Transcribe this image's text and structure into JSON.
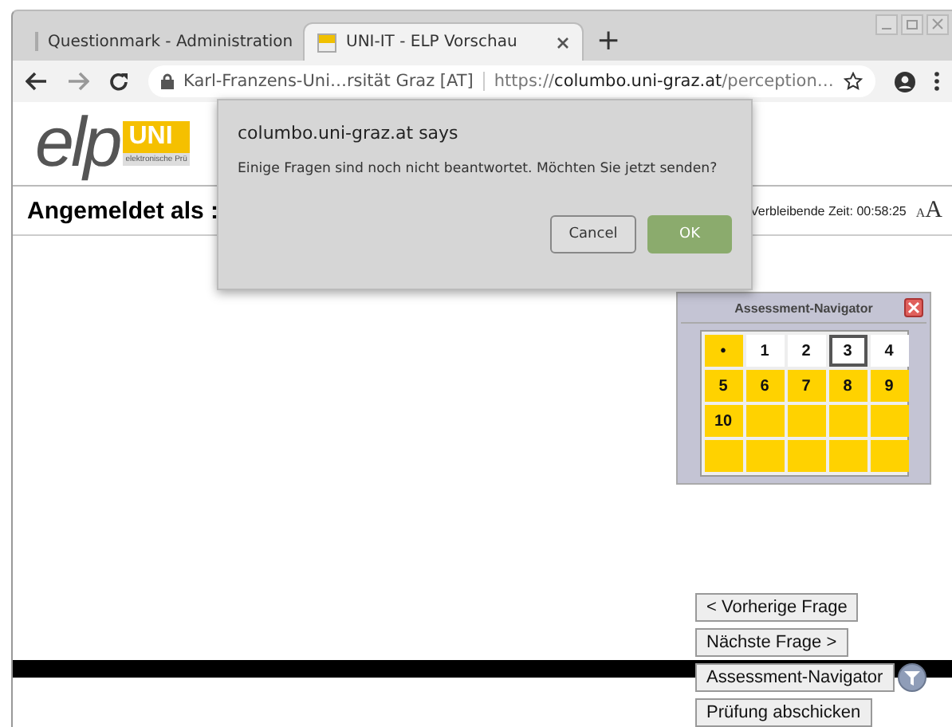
{
  "browser": {
    "tabs": [
      {
        "title": "Questionmark - Administration",
        "selected": false
      },
      {
        "title": "UNI-IT - ELP Vorschau",
        "selected": true
      }
    ],
    "new_tab": "+",
    "address": {
      "security_label": "Karl-Franzens-Uni…rsität Graz [AT]",
      "url_scheme": "https://",
      "url_host": "columbo.uni-graz.at",
      "url_path": "/perception…"
    }
  },
  "page": {
    "logo": {
      "wordmark": "elp",
      "badge": "UNI",
      "tagline": "elektronische Prü"
    },
    "login_label": "Angemeldet als :",
    "timer": "Verbleibende Zeit: 00:58:25",
    "font_size_button": {
      "small": "A",
      "large": "A"
    }
  },
  "navigator": {
    "title": "Assessment-Navigator",
    "cells": [
      {
        "label": "•",
        "answered": true,
        "selected": false
      },
      {
        "label": "1",
        "answered": false,
        "selected": false
      },
      {
        "label": "2",
        "answered": false,
        "selected": false
      },
      {
        "label": "3",
        "answered": false,
        "selected": true
      },
      {
        "label": "4",
        "answered": false,
        "selected": false
      },
      {
        "label": "5",
        "answered": true,
        "selected": false
      },
      {
        "label": "6",
        "answered": true,
        "selected": false
      },
      {
        "label": "7",
        "answered": true,
        "selected": false
      },
      {
        "label": "8",
        "answered": true,
        "selected": false
      },
      {
        "label": "9",
        "answered": true,
        "selected": false
      },
      {
        "label": "10",
        "answered": true,
        "selected": false
      },
      {
        "answered": true,
        "selected": false
      },
      {
        "answered": true,
        "selected": false
      },
      {
        "answered": true,
        "selected": false
      },
      {
        "answered": true,
        "selected": false
      },
      {
        "answered": true,
        "selected": false
      },
      {
        "answered": true,
        "selected": false
      },
      {
        "answered": true,
        "selected": false
      },
      {
        "answered": true,
        "selected": false
      },
      {
        "answered": true,
        "selected": false
      }
    ]
  },
  "buttons": [
    {
      "label": "< Vorherige Frage",
      "icon": false
    },
    {
      "label": "Nächste Frage >",
      "icon": false
    },
    {
      "label": "Assessment-Navigator",
      "icon": true
    },
    {
      "label": "Prüfung abschicken",
      "icon": false
    }
  ],
  "dialog": {
    "origin": "columbo.uni-graz.at says",
    "message": "Einige Fragen sind noch nicht beantwortet. Möchten Sie jetzt senden?",
    "buttons": [
      {
        "label": "Cancel",
        "kind": "secondary"
      },
      {
        "label": "OK",
        "kind": "primary"
      }
    ]
  }
}
